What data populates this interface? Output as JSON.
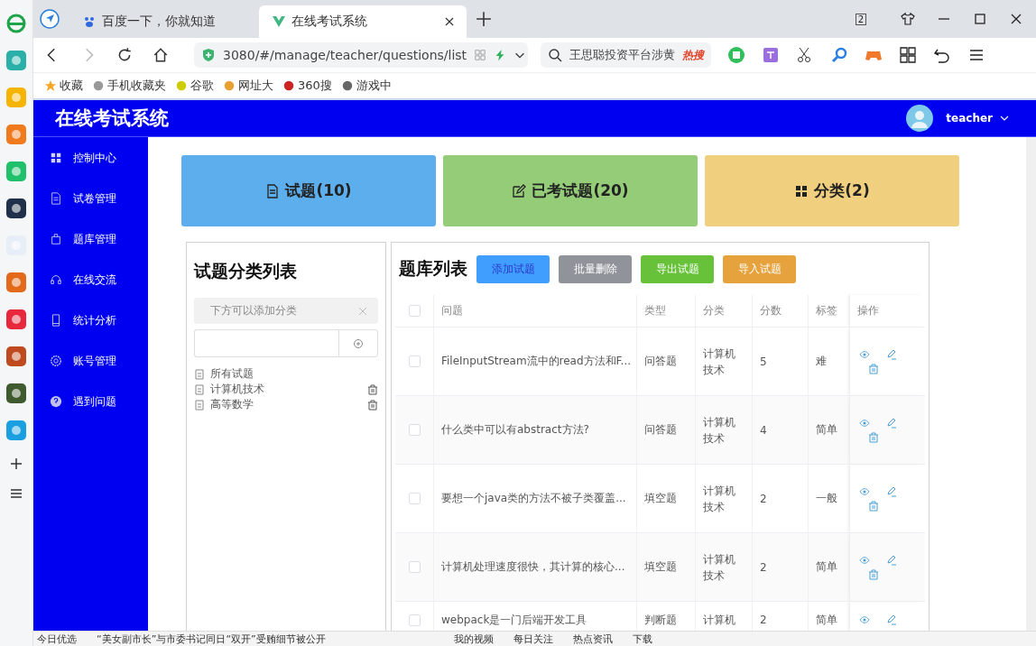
{
  "browser": {
    "tabs": [
      {
        "label": "百度一下，你就知道",
        "selected": false
      },
      {
        "label": "在线考试系统",
        "selected": true
      }
    ],
    "tab_count": "2",
    "url": "3080/#/manage/teacher/questions/list",
    "search": {
      "value": "王思聪投资平台涉黄",
      "badge": "热搜"
    },
    "bookmarks": [
      "收藏",
      "手机收藏夹",
      "谷歌",
      "网址大",
      "360搜",
      "游戏中"
    ]
  },
  "app": {
    "title": "在线考试系统",
    "user": "teacher"
  },
  "sidebar": {
    "items": [
      {
        "label": "控制中心",
        "kind": "grid"
      },
      {
        "label": "试卷管理",
        "kind": "doc"
      },
      {
        "label": "题库管理",
        "kind": "bag"
      },
      {
        "label": "在线交流",
        "kind": "headset"
      },
      {
        "label": "统计分析",
        "kind": "phone"
      },
      {
        "label": "账号管理",
        "kind": "gear"
      },
      {
        "label": "遇到问题",
        "kind": "help"
      }
    ]
  },
  "cards": [
    {
      "label": "试题(10)",
      "kind": "doc",
      "color": "#5caeec"
    },
    {
      "label": "已考试题(20)",
      "kind": "edit",
      "color": "#95cc78"
    },
    {
      "label": "分类(2)",
      "kind": "grid",
      "color": "#f0cf7e"
    }
  ],
  "categories": {
    "title": "试题分类列表",
    "alert": "下方可以添加分类",
    "items": [
      {
        "label": "所有试题",
        "deletable": false
      },
      {
        "label": "计算机技术",
        "deletable": true
      },
      {
        "label": "高等数学",
        "deletable": true
      }
    ]
  },
  "questions": {
    "title": "题库列表",
    "buttons": [
      {
        "label": "添加试题",
        "color": "#409eff"
      },
      {
        "label": "批量删除",
        "color": "#909399"
      },
      {
        "label": "导出试题",
        "color": "#67c23a"
      },
      {
        "label": "导入试题",
        "color": "#e6a23c"
      }
    ],
    "header_checked": false,
    "columns": [
      "问题",
      "类型",
      "分类",
      "分数",
      "标签",
      "操作"
    ],
    "rows": [
      {
        "question": "FileInputStream流中的read方法和F...",
        "type": "问答题",
        "category": "计算机技术",
        "score": "5",
        "tag": "难",
        "checked": false
      },
      {
        "question": "什么类中可以有abstract方法?",
        "type": "问答题",
        "category": "计算机技术",
        "score": "4",
        "tag": "简单",
        "checked": false
      },
      {
        "question": "要想一个java类的方法不被子类覆盖...",
        "type": "填空题",
        "category": "计算机技术",
        "score": "2",
        "tag": "一般",
        "checked": false
      },
      {
        "question": "计算机处理速度很快，其计算的核心...",
        "type": "填空题",
        "category": "计算机技术",
        "score": "2",
        "tag": "简单",
        "checked": false
      },
      {
        "question": "webpack是一门后端开发工具",
        "type": "判断题",
        "category": "计算机",
        "score": "2",
        "tag": "简单",
        "checked": false
      }
    ]
  },
  "status_bar": {
    "items": [
      "今日优选",
      "“美女副市长”与市委书记同日“双开”受贿细节被公开",
      "我的视频",
      "每日关注",
      "热点资讯",
      "下载"
    ]
  }
}
